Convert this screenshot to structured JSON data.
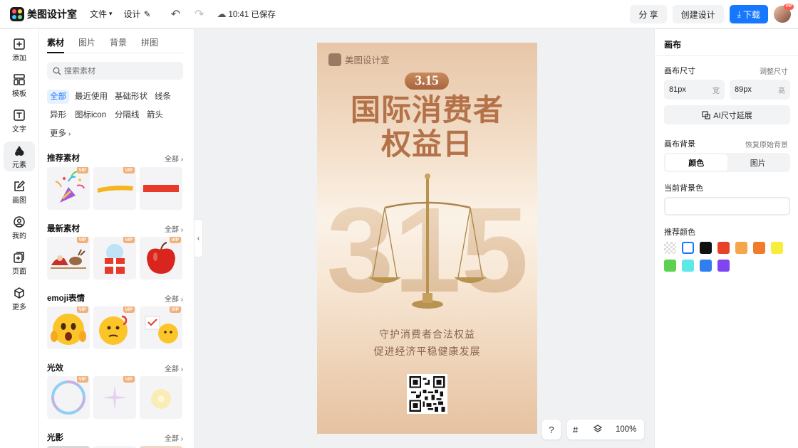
{
  "app": {
    "name": "美图设计室"
  },
  "toolbar": {
    "file_menu": "文件",
    "design_menu": "设计",
    "save_status": "10:41 已保存",
    "share_label": "分 享",
    "create_label": "创建设计",
    "download_label": "下载",
    "vip_badge": "VIP"
  },
  "nav": {
    "items": [
      {
        "label": "添加",
        "icon": "plus-square-icon"
      },
      {
        "label": "模板",
        "icon": "template-icon"
      },
      {
        "label": "文字",
        "icon": "text-icon"
      },
      {
        "label": "元素",
        "icon": "shapes-icon"
      },
      {
        "label": "画图",
        "icon": "edit-icon"
      },
      {
        "label": "我的",
        "icon": "user-icon"
      },
      {
        "label": "页面",
        "icon": "page-add-icon"
      },
      {
        "label": "更多",
        "icon": "cube-icon"
      }
    ]
  },
  "panel": {
    "tabs": [
      "素材",
      "图片",
      "背景",
      "拼图"
    ],
    "search_placeholder": "搜索素材",
    "chips": [
      "全部",
      "最近使用",
      "基础形状",
      "线条",
      "异形",
      "图标icon",
      "分隔线",
      "箭头",
      "更多"
    ],
    "all_label": "全部",
    "sections": [
      {
        "title": "推荐素材",
        "items": [
          "party-popper",
          "yellow-brush-stroke",
          "red-bar"
        ]
      },
      {
        "title": "最新素材",
        "items": [
          "reindeer-sleigh",
          "christmas-gift",
          "red-apple"
        ]
      },
      {
        "title": "emoji表情",
        "items": [
          "shocked-emoji",
          "thinking-emoji",
          "note-emoji"
        ]
      },
      {
        "title": "光效",
        "items": [
          "bubble-ring",
          "star-sparkle",
          "soft-glow"
        ]
      },
      {
        "title": "光影",
        "items": []
      }
    ]
  },
  "poster": {
    "brand": "美图设计室",
    "date_badge": "3.15",
    "title_line1": "国际消费者",
    "title_line2": "权益日",
    "big_number": "315",
    "subtitle_line1": "守护消费者合法权益",
    "subtitle_line2": "促进经济平稳健康发展"
  },
  "canvas_controls": {
    "help": "?",
    "zoom": "100%"
  },
  "right_panel": {
    "title": "画布",
    "size_label": "画布尺寸",
    "adjust_label": "调整尺寸",
    "width_value": "81px",
    "width_unit": "宽",
    "height_value": "89px",
    "height_unit": "高",
    "ai_extend_label": "AI尺寸延展",
    "bg_label": "画布背景",
    "restore_label": "恢复原始背景",
    "seg_color": "颜色",
    "seg_image": "图片",
    "current_bg_label": "当前背景色",
    "recommend_label": "推荐颜色",
    "swatches": [
      "transparent",
      "#ffffff",
      "#111111",
      "#e8412a",
      "#f5a64a",
      "#f07b2a",
      "#f7ee3b",
      "#5cd150",
      "#5ce8e8",
      "#2f7ff0",
      "#7f45f0"
    ]
  },
  "colors": {
    "accent": "#1677ff",
    "poster_title": "#b47249",
    "poster_badge": "#a8643c"
  }
}
